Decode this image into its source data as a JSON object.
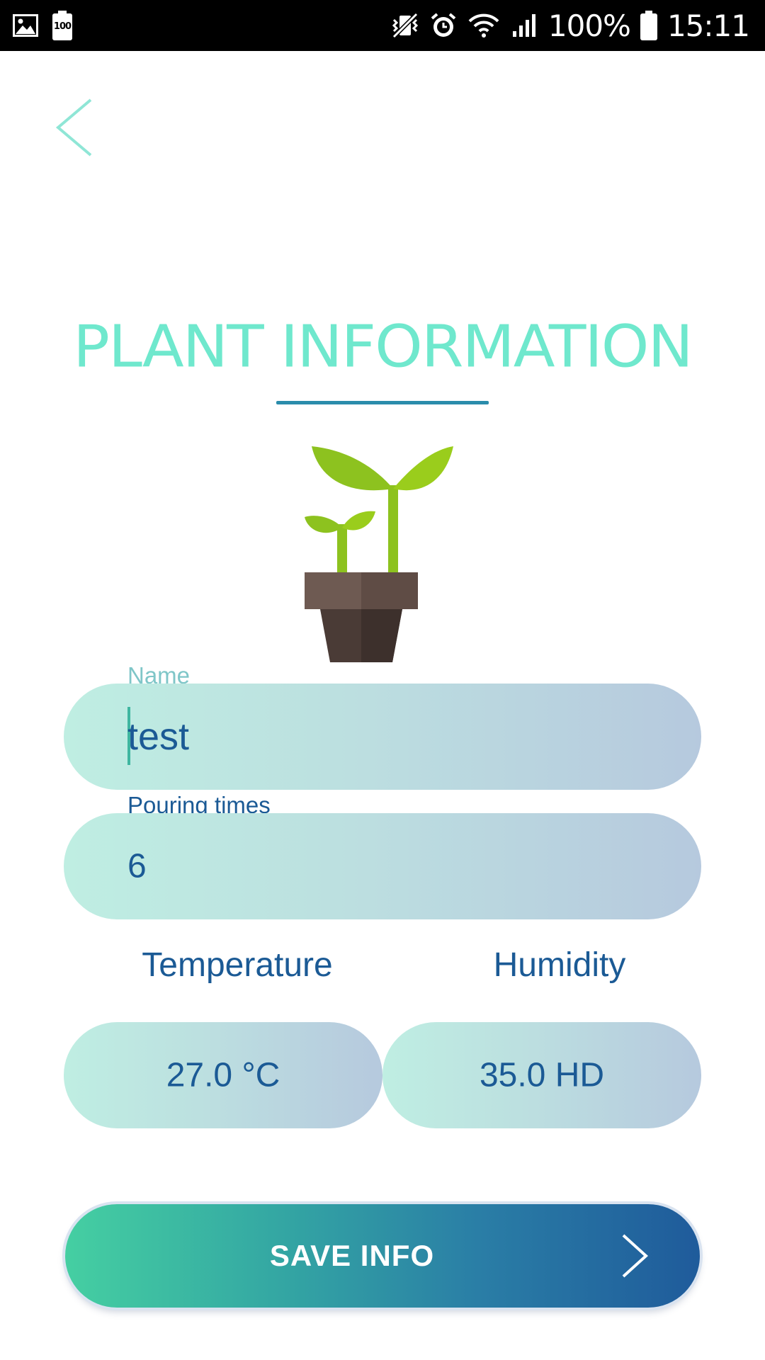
{
  "status_bar": {
    "icons": [
      "gallery-icon",
      "battery-saver-icon",
      "vibrate-icon",
      "alarm-icon",
      "wifi-icon",
      "signal-icon",
      "battery-icon"
    ],
    "saver_badge": "100",
    "battery": "100%",
    "time": "15:11"
  },
  "header": {
    "back_icon": "chevron-left-icon",
    "title": "PLANT INFORMATION",
    "colors": {
      "title": "#6fe8cd",
      "underline": "#2a8cab"
    }
  },
  "plant_icon": "potted-seedling-icon",
  "form": {
    "name_label": "Name",
    "name_value": "test",
    "pouring_label": "Pouring times",
    "pouring_value": "6",
    "temperature_label": "Temperature",
    "temperature_value": "27.0 °C",
    "humidity_label": "Humidity",
    "humidity_value": "35.0 HD"
  },
  "save_button": {
    "label": "SAVE INFO",
    "icon": "chevron-right-icon",
    "gradient": [
      "#45cfa2",
      "#1f5b9b"
    ]
  },
  "colors": {
    "text": "#1b5a95",
    "field_gradient": [
      "#bfeee2",
      "#b6c9de"
    ]
  }
}
